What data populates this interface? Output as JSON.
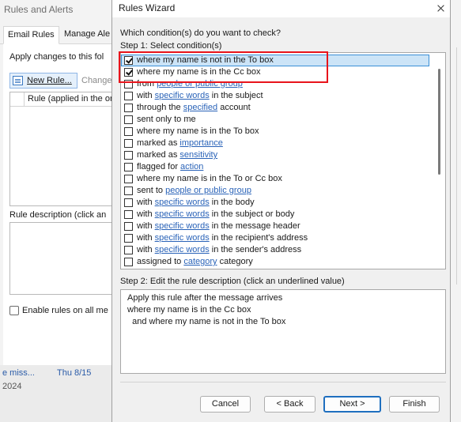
{
  "background_window": {
    "title": "Rules and Alerts",
    "tabs": [
      "Email Rules",
      "Manage Ale"
    ],
    "apply_changes_label": "Apply changes to this fol",
    "new_rule_label": "New Rule...",
    "change_label": "Change",
    "list_header": "Rule (applied in the ord",
    "description_label": "Rule description (click an",
    "enable_rules_label": "Enable rules on all me",
    "mail_preview": {
      "subject": "e miss...",
      "date": "Thu 8/15",
      "year": "2024"
    }
  },
  "wizard": {
    "title": "Rules Wizard",
    "question": "Which condition(s) do you want to check?",
    "step1_label": "Step 1: Select condition(s)",
    "conditions": [
      {
        "checked": true,
        "selected": true,
        "parts": [
          {
            "t": "where my name is not in the To box"
          }
        ]
      },
      {
        "checked": true,
        "selected": false,
        "parts": [
          {
            "t": "where my name is in the Cc box"
          }
        ]
      },
      {
        "checked": false,
        "selected": false,
        "parts": [
          {
            "t": "from "
          },
          {
            "t": "people or public group",
            "link": true
          }
        ]
      },
      {
        "checked": false,
        "selected": false,
        "parts": [
          {
            "t": "with "
          },
          {
            "t": "specific words",
            "link": true
          },
          {
            "t": " in the subject"
          }
        ]
      },
      {
        "checked": false,
        "selected": false,
        "parts": [
          {
            "t": "through the "
          },
          {
            "t": "specified",
            "link": true
          },
          {
            "t": " account"
          }
        ]
      },
      {
        "checked": false,
        "selected": false,
        "parts": [
          {
            "t": "sent only to me"
          }
        ]
      },
      {
        "checked": false,
        "selected": false,
        "parts": [
          {
            "t": "where my name is in the To box"
          }
        ]
      },
      {
        "checked": false,
        "selected": false,
        "parts": [
          {
            "t": "marked as "
          },
          {
            "t": "importance",
            "link": true
          }
        ]
      },
      {
        "checked": false,
        "selected": false,
        "parts": [
          {
            "t": "marked as "
          },
          {
            "t": "sensitivity",
            "link": true
          }
        ]
      },
      {
        "checked": false,
        "selected": false,
        "parts": [
          {
            "t": "flagged for "
          },
          {
            "t": "action",
            "link": true
          }
        ]
      },
      {
        "checked": false,
        "selected": false,
        "parts": [
          {
            "t": "where my name is in the To or Cc box"
          }
        ]
      },
      {
        "checked": false,
        "selected": false,
        "parts": [
          {
            "t": "sent to "
          },
          {
            "t": "people or public group",
            "link": true
          }
        ]
      },
      {
        "checked": false,
        "selected": false,
        "parts": [
          {
            "t": "with "
          },
          {
            "t": "specific words",
            "link": true
          },
          {
            "t": " in the body"
          }
        ]
      },
      {
        "checked": false,
        "selected": false,
        "parts": [
          {
            "t": "with "
          },
          {
            "t": "specific words",
            "link": true
          },
          {
            "t": " in the subject or body"
          }
        ]
      },
      {
        "checked": false,
        "selected": false,
        "parts": [
          {
            "t": "with "
          },
          {
            "t": "specific words",
            "link": true
          },
          {
            "t": " in the message header"
          }
        ]
      },
      {
        "checked": false,
        "selected": false,
        "parts": [
          {
            "t": "with "
          },
          {
            "t": "specific words",
            "link": true
          },
          {
            "t": " in the recipient's address"
          }
        ]
      },
      {
        "checked": false,
        "selected": false,
        "parts": [
          {
            "t": "with "
          },
          {
            "t": "specific words",
            "link": true
          },
          {
            "t": " in the sender's address"
          }
        ]
      },
      {
        "checked": false,
        "selected": false,
        "parts": [
          {
            "t": "assigned to "
          },
          {
            "t": "category",
            "link": true
          },
          {
            "t": " category"
          }
        ]
      }
    ],
    "step2_label": "Step 2: Edit the rule description (click an underlined value)",
    "description_lines": [
      "Apply this rule after the message arrives",
      "where my name is in the Cc box",
      "  and where my name is not in the To box"
    ],
    "buttons": {
      "cancel": "Cancel",
      "back": "< Back",
      "next": "Next >",
      "finish": "Finish"
    },
    "highlight_color": "#e8141b",
    "link_color": "#2a63b8"
  }
}
